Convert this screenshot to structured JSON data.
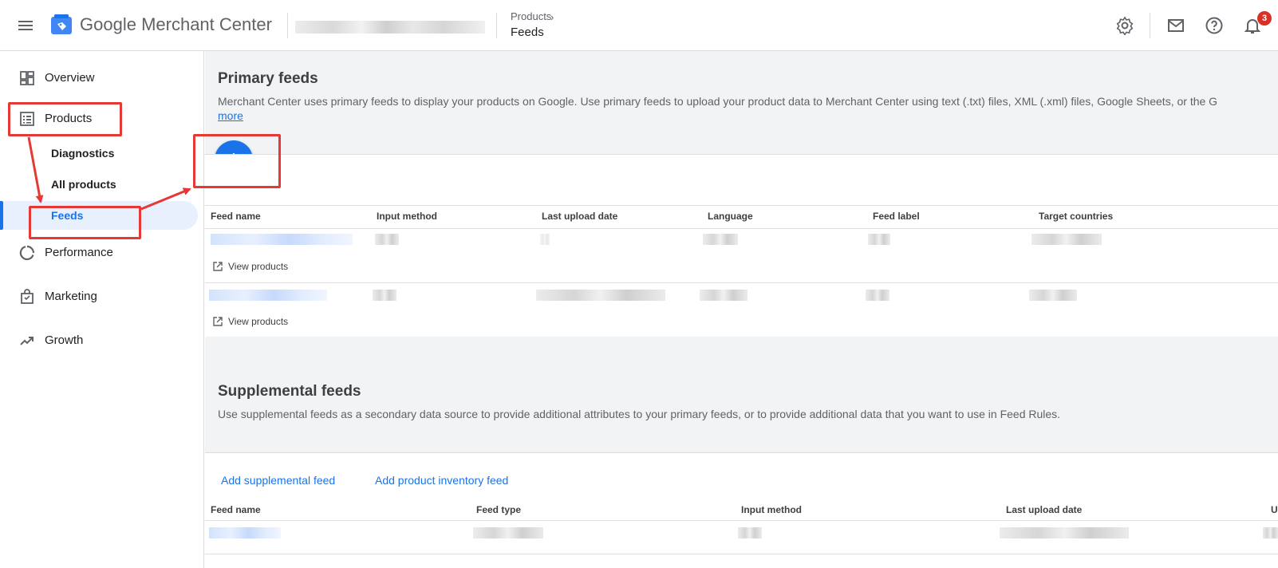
{
  "header": {
    "brand_google": "Google",
    "brand_product": "Merchant Center",
    "breadcrumb_parent": "Products",
    "breadcrumb_current": "Feeds",
    "notification_count": "3",
    "icons": [
      "menu-icon",
      "merchant-logo-icon",
      "gear-icon",
      "mail-icon",
      "help-icon",
      "bell-icon"
    ]
  },
  "sidebar": {
    "items": [
      {
        "label": "Overview",
        "icon": "dashboard-icon"
      },
      {
        "label": "Products",
        "icon": "list-icon"
      },
      {
        "label": "Performance",
        "icon": "donut-icon"
      },
      {
        "label": "Marketing",
        "icon": "bag-icon"
      },
      {
        "label": "Growth",
        "icon": "trend-icon"
      }
    ],
    "products_sub": [
      {
        "label": "Diagnostics"
      },
      {
        "label": "All products"
      },
      {
        "label": "Feeds",
        "active": true
      }
    ]
  },
  "primary": {
    "title": "Primary feeds",
    "description": "Merchant Center uses primary feeds to display your products on Google. Use primary feeds to upload your product data to Merchant Center using text (.txt) files, XML (.xml) files, Google Sheets, or the G",
    "more_label": "more",
    "columns": [
      "Feed name",
      "Input method",
      "Last upload date",
      "Language",
      "Feed label",
      "Target countries"
    ],
    "view_products_label": "View products"
  },
  "supplemental": {
    "title": "Supplemental feeds",
    "description": "Use supplemental feeds as a secondary data source to provide additional attributes to your primary feeds, or to provide additional data that you want to use in Feed Rules.",
    "add_supplemental_label": "Add supplemental feed",
    "add_inventory_label": "Add product inventory feed",
    "columns": [
      "Feed name",
      "Feed type",
      "Input method",
      "Last upload date",
      "U"
    ]
  },
  "colors": {
    "accent": "#1a73e8",
    "annotation": "#e53935",
    "active_bg": "#e8f0fe"
  }
}
